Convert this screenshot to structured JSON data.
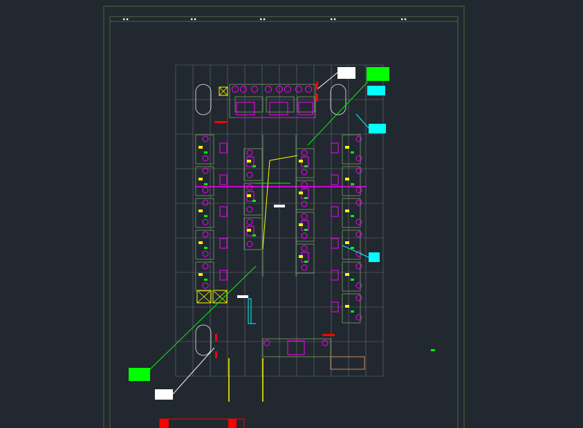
{
  "viewport": {
    "background": "#212830"
  },
  "drawing": {
    "title_block_marks": [
      "■ ■",
      "■ ■",
      "■ ■",
      "■ ■",
      "■ ■"
    ],
    "grid_columns": 12,
    "grid_rows": 9,
    "layer_colors": {
      "sheet_border": "#4a6a3a",
      "grid": "#6b737b",
      "magenta": "#ff00ff",
      "green": "#00ff00",
      "cyan": "#00ffff",
      "yellow": "#ffff00",
      "white": "#ffffff",
      "red": "#ff0000",
      "dark_green": "#6a8a5a",
      "brown": "#b07a5a"
    }
  }
}
